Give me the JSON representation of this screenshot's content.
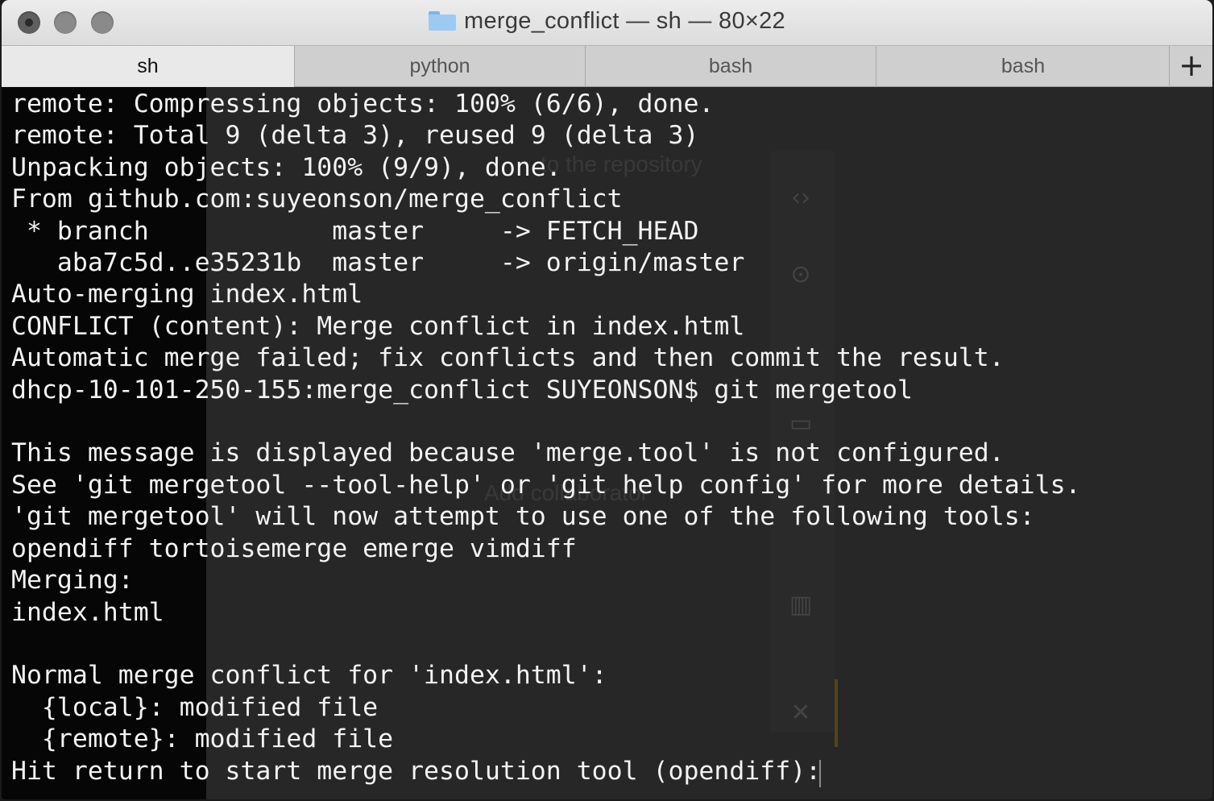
{
  "window": {
    "title": "merge_conflict — sh — 80×22"
  },
  "tabs": [
    {
      "label": "sh",
      "active": true
    },
    {
      "label": "python",
      "active": false
    },
    {
      "label": "bash",
      "active": false
    },
    {
      "label": "bash",
      "active": false
    }
  ],
  "new_tab_label": "+",
  "terminal": {
    "lines": [
      "remote: Compressing objects: 100% (6/6), done.",
      "remote: Total 9 (delta 3), reused 9 (delta 3)",
      "Unpacking objects: 100% (9/9), done.",
      "From github.com:suyeonson/merge_conflict",
      " * branch            master     -> FETCH_HEAD",
      "   aba7c5d..e35231b  master     -> origin/master",
      "Auto-merging index.html",
      "CONFLICT (content): Merge conflict in index.html",
      "Automatic merge failed; fix conflicts and then commit the result.",
      "dhcp-10-101-250-155:merge_conflict SUYEONSON$ git mergetool",
      "",
      "This message is displayed because 'merge.tool' is not configured.",
      "See 'git mergetool --tool-help' or 'git help config' for more details.",
      "'git mergetool' will now attempt to use one of the following tools:",
      "opendiff tortoisemerge emerge vimdiff",
      "Merging:",
      "index.html",
      "",
      "Normal merge conflict for 'index.html':",
      "  {local}: modified file",
      "  {remote}: modified file",
      "Hit return to start merge resolution tool (opendiff): "
    ]
  },
  "background_window": {
    "text_1": "to the repository",
    "text_2": "Add collaborator"
  },
  "colors": {
    "terminal_bg": "#060606",
    "terminal_fg": "#f3f3f3",
    "tab_active": "#e9e9e9",
    "tab_inactive": "#cfcfcf"
  }
}
